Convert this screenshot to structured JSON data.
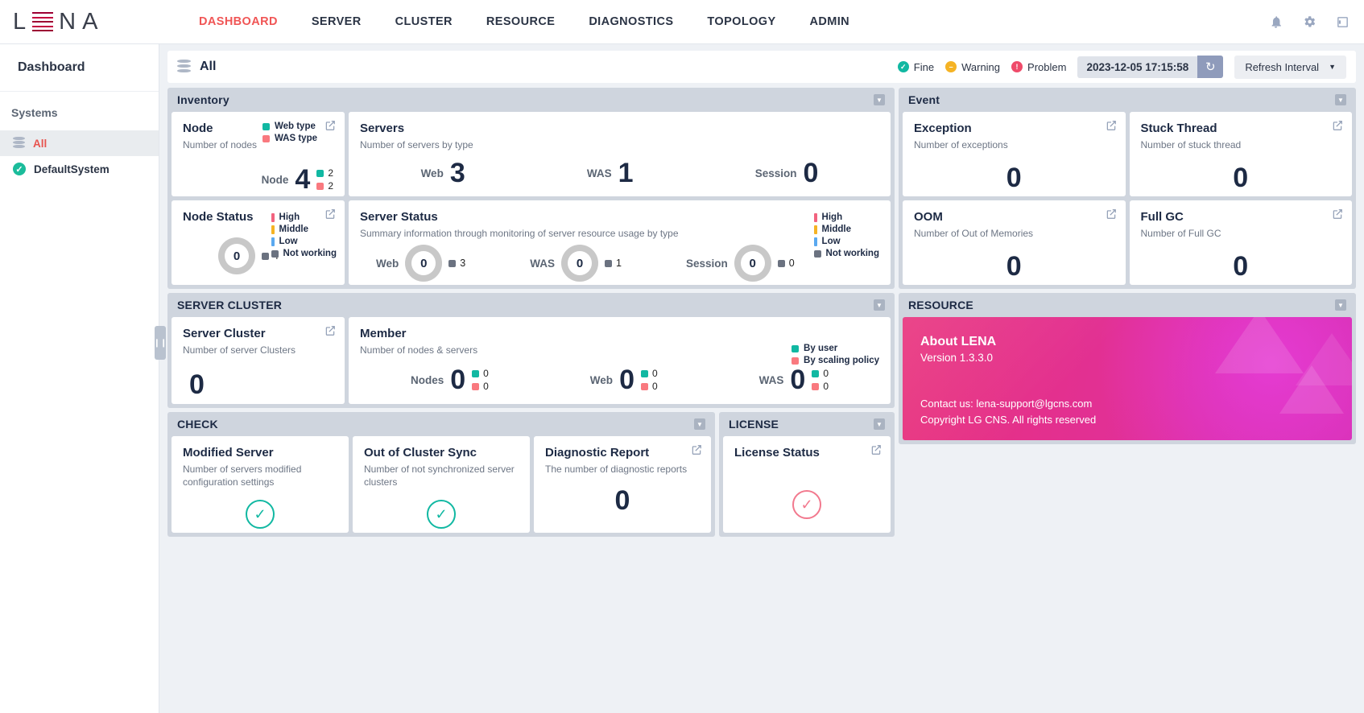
{
  "brand": {
    "letters": [
      "L",
      "N",
      "A"
    ]
  },
  "nav": {
    "items": [
      {
        "label": "DASHBOARD",
        "active": true
      },
      {
        "label": "SERVER",
        "active": false
      },
      {
        "label": "CLUSTER",
        "active": false
      },
      {
        "label": "RESOURCE",
        "active": false
      },
      {
        "label": "DIAGNOSTICS",
        "active": false
      },
      {
        "label": "TOPOLOGY",
        "active": false
      },
      {
        "label": "ADMIN",
        "active": false
      }
    ],
    "icons": [
      "bell-icon",
      "gear-icon",
      "logout-icon"
    ]
  },
  "sidebar": {
    "title": "Dashboard",
    "group_label": "Systems",
    "items": [
      {
        "label": "All",
        "icon": "database-icon",
        "selected": true
      },
      {
        "label": "DefaultSystem",
        "icon": "check-circle-icon",
        "selected": false
      }
    ]
  },
  "content_header": {
    "scope": "All",
    "scope_icon": "database-icon",
    "status_legend": [
      {
        "label": "Fine",
        "color": "#11b8a2"
      },
      {
        "label": "Warning",
        "color": "#f5b324"
      },
      {
        "label": "Problem",
        "color": "#ef4b6a"
      }
    ],
    "timestamp": "2023-12-05 17:15:58",
    "refresh_icon": "refresh-icon",
    "refresh_interval_label": "Refresh Interval"
  },
  "panels": {
    "inventory": {
      "title": "Inventory",
      "node": {
        "title": "Node",
        "desc": "Number of nodes",
        "legend": [
          {
            "label": "Web type",
            "color": "#11b8a2"
          },
          {
            "label": "WAS type",
            "color": "#f9797f"
          }
        ],
        "metric_label": "Node",
        "metric_value": "4",
        "breakdown": [
          {
            "color": "#11b8a2",
            "value": "2"
          },
          {
            "color": "#f9797f",
            "value": "2"
          }
        ]
      },
      "servers": {
        "title": "Servers",
        "desc": "Number of servers by type",
        "metrics": [
          {
            "label": "Web",
            "value": "3"
          },
          {
            "label": "WAS",
            "value": "1"
          },
          {
            "label": "Session",
            "value": "0"
          }
        ]
      },
      "node_status": {
        "title": "Node Status",
        "legend": [
          {
            "label": "High",
            "color": "#f2637f"
          },
          {
            "label": "Middle",
            "color": "#f5b324"
          },
          {
            "label": "Low",
            "color": "#5aa9f0"
          },
          {
            "label": "Not working",
            "color": "#6b7280"
          }
        ],
        "donut_value": "0",
        "not_working": "4"
      },
      "server_status": {
        "title": "Server Status",
        "desc": "Summary information through monitoring of server resource usage by type",
        "legend": [
          {
            "label": "High",
            "color": "#f2637f"
          },
          {
            "label": "Middle",
            "color": "#f5b324"
          },
          {
            "label": "Low",
            "color": "#5aa9f0"
          },
          {
            "label": "Not working",
            "color": "#6b7280"
          }
        ],
        "metrics": [
          {
            "label": "Web",
            "donut_value": "0",
            "not_working": "3"
          },
          {
            "label": "WAS",
            "donut_value": "0",
            "not_working": "1"
          },
          {
            "label": "Session",
            "donut_value": "0",
            "not_working": "0"
          }
        ]
      }
    },
    "server_cluster": {
      "title": "SERVER CLUSTER",
      "cluster": {
        "title": "Server Cluster",
        "desc": "Number of server Clusters",
        "value": "0"
      },
      "member": {
        "title": "Member",
        "desc": "Number of nodes & servers",
        "legend": [
          {
            "label": "By user",
            "color": "#11b8a2"
          },
          {
            "label": "By scaling policy",
            "color": "#f9797f"
          }
        ],
        "metrics": [
          {
            "label": "Nodes",
            "value": "0",
            "breakdown": [
              {
                "color": "#11b8a2",
                "value": "0"
              },
              {
                "color": "#f9797f",
                "value": "0"
              }
            ]
          },
          {
            "label": "Web",
            "value": "0",
            "breakdown": [
              {
                "color": "#11b8a2",
                "value": "0"
              },
              {
                "color": "#f9797f",
                "value": "0"
              }
            ]
          },
          {
            "label": "WAS",
            "value": "0",
            "breakdown": [
              {
                "color": "#11b8a2",
                "value": "0"
              },
              {
                "color": "#f9797f",
                "value": "0"
              }
            ]
          }
        ]
      }
    },
    "check": {
      "title": "CHECK",
      "cards": [
        {
          "title": "Modified Server",
          "desc": "Number of servers modified configuration settings",
          "state": "ok",
          "icon": "check-circle-icon"
        },
        {
          "title": "Out of Cluster Sync",
          "desc": "Number of not synchronized server clusters",
          "state": "ok",
          "icon": "check-circle-icon"
        },
        {
          "title": "Diagnostic Report",
          "desc": "The number of diagnostic reports",
          "value": "0"
        }
      ]
    },
    "license": {
      "title": "LICENSE",
      "card": {
        "title": "License Status",
        "state": "bad",
        "icon": "check-circle-icon"
      }
    },
    "event": {
      "title": "Event",
      "cards": [
        {
          "title": "Exception",
          "desc": "Number of exceptions",
          "value": "0"
        },
        {
          "title": "Stuck Thread",
          "desc": "Number of stuck thread",
          "value": "0"
        },
        {
          "title": "OOM",
          "desc": "Number of Out of Memories",
          "value": "0"
        },
        {
          "title": "Full GC",
          "desc": "Number of Full GC",
          "value": "0"
        }
      ]
    },
    "resource": {
      "title": "RESOURCE",
      "about": {
        "heading": "About LENA",
        "version": "Version 1.3.3.0",
        "contact": "Contact us: lena-support@lgcns.com",
        "copyright": "Copyright LG CNS. All rights reserved"
      }
    }
  }
}
